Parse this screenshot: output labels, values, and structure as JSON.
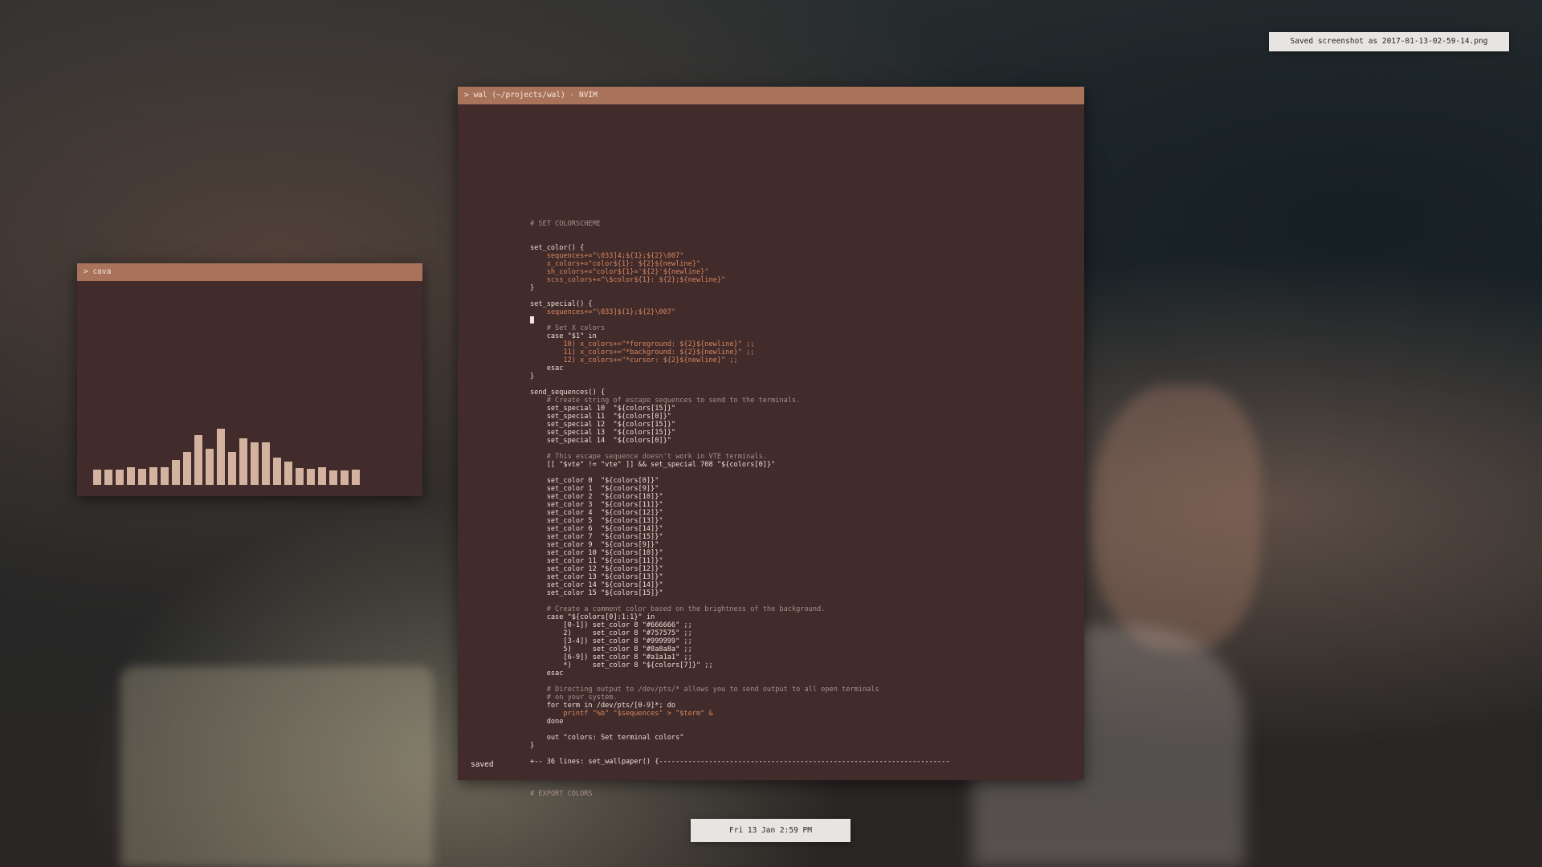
{
  "notification": {
    "text": "Saved screenshot as 2017-01-13-02-59-14.png"
  },
  "clock": {
    "text": "Fri 13 Jan  2:59 PM"
  },
  "nvim_window": {
    "title": "> wal (~/projects/wal) - NVIM",
    "status": "saved",
    "lines": [
      "",
      "",
      "",
      "",
      "",
      "",
      "",
      "# SET COLORSCHEME",
      "",
      "",
      "set_color() {",
      "    sequences+=\"\\033]4;${1};${2}\\007\"",
      "    x_colors+=\"color${1}: ${2}${newline}\"",
      "    sh_colors+=\"color${1}='${2}'${newline}\"",
      "    scss_colors+=\"\\$color${1}: ${2};${newline}\"",
      "}",
      "",
      "set_special() {",
      "    sequences+=\"\\033]${1};${2}\\007\"",
      "",
      "    # Set X colors",
      "    case \"$1\" in",
      "        10) x_colors+=\"*foreground: ${2}${newline}\" ;;",
      "        11) x_colors+=\"*background: ${2}${newline}\" ;;",
      "        12) x_colors+=\"*cursor: ${2}${newline}\" ;;",
      "    esac",
      "}",
      "",
      "send_sequences() {",
      "    # Create string of escape sequences to send to the terminals.",
      "    set_special 10  \"${colors[15]}\"",
      "    set_special 11  \"${colors[0]}\"",
      "    set_special 12  \"${colors[15]}\"",
      "    set_special 13  \"${colors[15]}\"",
      "    set_special 14  \"${colors[0]}\"",
      "",
      "    # This escape sequence doesn't work in VTE terminals.",
      "    [[ \"$vte\" != \"vte\" ]] && set_special 708 \"${colors[0]}\"",
      "",
      "    set_color 0  \"${colors[0]}\"",
      "    set_color 1  \"${colors[9]}\"",
      "    set_color 2  \"${colors[10]}\"",
      "    set_color 3  \"${colors[11]}\"",
      "    set_color 4  \"${colors[12]}\"",
      "    set_color 5  \"${colors[13]}\"",
      "    set_color 6  \"${colors[14]}\"",
      "    set_color 7  \"${colors[15]}\"",
      "    set_color 9  \"${colors[9]}\"",
      "    set_color 10 \"${colors[10]}\"",
      "    set_color 11 \"${colors[11]}\"",
      "    set_color 12 \"${colors[12]}\"",
      "    set_color 13 \"${colors[13]}\"",
      "    set_color 14 \"${colors[14]}\"",
      "    set_color 15 \"${colors[15]}\"",
      "",
      "    # Create a comment color based on the brightness of the background.",
      "    case \"${colors[0]:1:1}\" in",
      "        [0-1]) set_color 8 \"#666666\" ;;",
      "        2)     set_color 8 \"#757575\" ;;",
      "        [3-4]) set_color 8 \"#999999\" ;;",
      "        5)     set_color 8 \"#8a8a8a\" ;;",
      "        [6-9]) set_color 8 \"#a1a1a1\" ;;",
      "        *)     set_color 8 \"${colors[7]}\" ;;",
      "    esac",
      "",
      "    # Directing output to /dev/pts/* allows you to send output to all open terminals",
      "    # on your system.",
      "    for term in /dev/pts/[0-9]*; do",
      "        printf \"%b\" \"$sequences\" > \"$term\" &",
      "    done",
      "",
      "    out \"colors: Set terminal colors\"",
      "}",
      "",
      "+-- 36 lines: set_wallpaper() {----------------------------------------------------------------------",
      "",
      "",
      "",
      "# EXPORT COLORS"
    ]
  },
  "cava_window": {
    "title": "> cava",
    "levels": [
      0.17,
      0.17,
      0.17,
      0.2,
      0.18,
      0.2,
      0.2,
      0.28,
      0.37,
      0.56,
      0.41,
      0.64,
      0.37,
      0.53,
      0.48,
      0.48,
      0.31,
      0.26,
      0.19,
      0.18,
      0.2,
      0.16,
      0.16,
      0.17
    ]
  },
  "colors": {
    "background": "#412b2b",
    "titlebar": "#a9735b",
    "foreground": "#ece0d8",
    "accent": "#d8885e",
    "comment": "#a7908a",
    "bar": "#d3b29f"
  }
}
